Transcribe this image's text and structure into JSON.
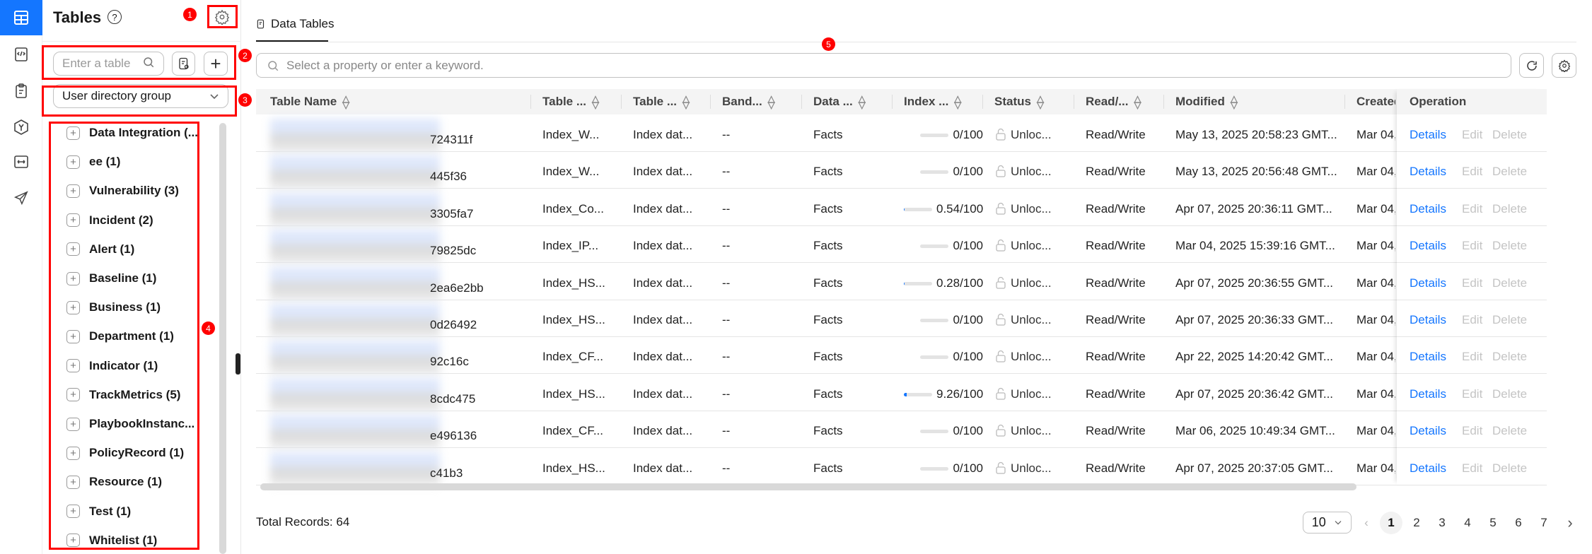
{
  "sidebar": {
    "title": "Tables",
    "search_placeholder": "Enter a table",
    "group_select": "User directory group",
    "groups": [
      "Data Integration (...",
      "ee (1)",
      "Vulnerability (3)",
      "Incident (2)",
      "Alert (1)",
      "Baseline (1)",
      "Business (1)",
      "Department (1)",
      "Indicator (1)",
      "TrackMetrics (5)",
      "PlaybookInstanc...",
      "PolicyRecord (1)",
      "Resource (1)",
      "Test (1)",
      "Whitelist (1)"
    ]
  },
  "annotations": [
    "1",
    "2",
    "3",
    "4",
    "5"
  ],
  "main": {
    "tab": "Data Tables",
    "search_placeholder": "Select a property or enter a keyword.",
    "columns": [
      "Table Name",
      "Table ...",
      "Table ...",
      "Band...",
      "Data ...",
      "Index ...",
      "Status",
      "Read/...",
      "Modified",
      "Created",
      "Operation"
    ],
    "rows": [
      {
        "name_suffix": "724311f",
        "type": "Index_W...",
        "desc": "Index dat...",
        "band": "--",
        "data": "Facts",
        "index_pct": 0,
        "index": "0/100",
        "status": "Unloc...",
        "rw": "Read/Write",
        "modified": "May 13, 2025 20:58:23 GMT...",
        "created": "Mar 04,"
      },
      {
        "name_suffix": "445f36",
        "type": "Index_W...",
        "desc": "Index dat...",
        "band": "--",
        "data": "Facts",
        "index_pct": 0,
        "index": "0/100",
        "status": "Unloc...",
        "rw": "Read/Write",
        "modified": "May 13, 2025 20:56:48 GMT...",
        "created": "Mar 04,"
      },
      {
        "name_suffix": "3305fa7",
        "type": "Index_Co...",
        "desc": "Index dat...",
        "band": "--",
        "data": "Facts",
        "index_pct": 0.54,
        "index": "0.54/100",
        "status": "Unloc...",
        "rw": "Read/Write",
        "modified": "Apr 07, 2025 20:36:11 GMT...",
        "created": "Mar 04,"
      },
      {
        "name_suffix": "79825dc",
        "type": "Index_IP...",
        "desc": "Index dat...",
        "band": "--",
        "data": "Facts",
        "index_pct": 0,
        "index": "0/100",
        "status": "Unloc...",
        "rw": "Read/Write",
        "modified": "Mar 04, 2025 15:39:16 GMT...",
        "created": "Mar 04,"
      },
      {
        "name_suffix": "2ea6e2bb",
        "type": "Index_HS...",
        "desc": "Index dat...",
        "band": "--",
        "data": "Facts",
        "index_pct": 0.28,
        "index": "0.28/100",
        "status": "Unloc...",
        "rw": "Read/Write",
        "modified": "Apr 07, 2025 20:36:55 GMT...",
        "created": "Mar 04,"
      },
      {
        "name_suffix": "0d26492",
        "type": "Index_HS...",
        "desc": "Index dat...",
        "band": "--",
        "data": "Facts",
        "index_pct": 0,
        "index": "0/100",
        "status": "Unloc...",
        "rw": "Read/Write",
        "modified": "Apr 07, 2025 20:36:33 GMT...",
        "created": "Mar 04,"
      },
      {
        "name_suffix": "92c16c",
        "type": "Index_CF...",
        "desc": "Index dat...",
        "band": "--",
        "data": "Facts",
        "index_pct": 0,
        "index": "0/100",
        "status": "Unloc...",
        "rw": "Read/Write",
        "modified": "Apr 22, 2025 14:20:42 GMT...",
        "created": "Mar 04,"
      },
      {
        "name_suffix": "8cdc475",
        "type": "Index_HS...",
        "desc": "Index dat...",
        "band": "--",
        "data": "Facts",
        "index_pct": 9.26,
        "index": "9.26/100",
        "status": "Unloc...",
        "rw": "Read/Write",
        "modified": "Apr 07, 2025 20:36:42 GMT...",
        "created": "Mar 04,"
      },
      {
        "name_suffix": "e496136",
        "type": "Index_CF...",
        "desc": "Index dat...",
        "band": "--",
        "data": "Facts",
        "index_pct": 0,
        "index": "0/100",
        "status": "Unloc...",
        "rw": "Read/Write",
        "modified": "Mar 06, 2025 10:49:34 GMT...",
        "created": "Mar 04,"
      },
      {
        "name_suffix": "c41b3",
        "type": "Index_HS...",
        "desc": "Index dat...",
        "band": "--",
        "data": "Facts",
        "index_pct": 0,
        "index": "0/100",
        "status": "Unloc...",
        "rw": "Read/Write",
        "modified": "Apr 07, 2025 20:37:05 GMT...",
        "created": "Mar 04,"
      }
    ],
    "ops": {
      "details": "Details",
      "edit": "Edit",
      "delete": "Delete"
    },
    "total": "Total Records: 64",
    "page_size": "10",
    "pages": [
      "1",
      "2",
      "3",
      "4",
      "5",
      "6",
      "7"
    ],
    "current_page": "1"
  },
  "colors": {
    "accent": "#1476ff",
    "annotation": "#ff0000"
  }
}
